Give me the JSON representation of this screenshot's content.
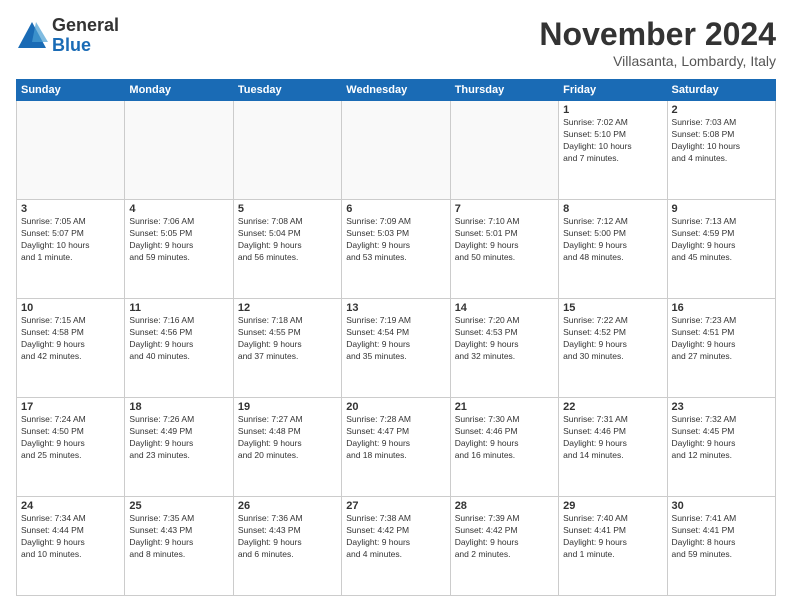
{
  "logo": {
    "general": "General",
    "blue": "Blue"
  },
  "title": "November 2024",
  "location": "Villasanta, Lombardy, Italy",
  "days_header": [
    "Sunday",
    "Monday",
    "Tuesday",
    "Wednesday",
    "Thursday",
    "Friday",
    "Saturday"
  ],
  "weeks": [
    [
      {
        "day": "",
        "info": ""
      },
      {
        "day": "",
        "info": ""
      },
      {
        "day": "",
        "info": ""
      },
      {
        "day": "",
        "info": ""
      },
      {
        "day": "",
        "info": ""
      },
      {
        "day": "1",
        "info": "Sunrise: 7:02 AM\nSunset: 5:10 PM\nDaylight: 10 hours\nand 7 minutes."
      },
      {
        "day": "2",
        "info": "Sunrise: 7:03 AM\nSunset: 5:08 PM\nDaylight: 10 hours\nand 4 minutes."
      }
    ],
    [
      {
        "day": "3",
        "info": "Sunrise: 7:05 AM\nSunset: 5:07 PM\nDaylight: 10 hours\nand 1 minute."
      },
      {
        "day": "4",
        "info": "Sunrise: 7:06 AM\nSunset: 5:05 PM\nDaylight: 9 hours\nand 59 minutes."
      },
      {
        "day": "5",
        "info": "Sunrise: 7:08 AM\nSunset: 5:04 PM\nDaylight: 9 hours\nand 56 minutes."
      },
      {
        "day": "6",
        "info": "Sunrise: 7:09 AM\nSunset: 5:03 PM\nDaylight: 9 hours\nand 53 minutes."
      },
      {
        "day": "7",
        "info": "Sunrise: 7:10 AM\nSunset: 5:01 PM\nDaylight: 9 hours\nand 50 minutes."
      },
      {
        "day": "8",
        "info": "Sunrise: 7:12 AM\nSunset: 5:00 PM\nDaylight: 9 hours\nand 48 minutes."
      },
      {
        "day": "9",
        "info": "Sunrise: 7:13 AM\nSunset: 4:59 PM\nDaylight: 9 hours\nand 45 minutes."
      }
    ],
    [
      {
        "day": "10",
        "info": "Sunrise: 7:15 AM\nSunset: 4:58 PM\nDaylight: 9 hours\nand 42 minutes."
      },
      {
        "day": "11",
        "info": "Sunrise: 7:16 AM\nSunset: 4:56 PM\nDaylight: 9 hours\nand 40 minutes."
      },
      {
        "day": "12",
        "info": "Sunrise: 7:18 AM\nSunset: 4:55 PM\nDaylight: 9 hours\nand 37 minutes."
      },
      {
        "day": "13",
        "info": "Sunrise: 7:19 AM\nSunset: 4:54 PM\nDaylight: 9 hours\nand 35 minutes."
      },
      {
        "day": "14",
        "info": "Sunrise: 7:20 AM\nSunset: 4:53 PM\nDaylight: 9 hours\nand 32 minutes."
      },
      {
        "day": "15",
        "info": "Sunrise: 7:22 AM\nSunset: 4:52 PM\nDaylight: 9 hours\nand 30 minutes."
      },
      {
        "day": "16",
        "info": "Sunrise: 7:23 AM\nSunset: 4:51 PM\nDaylight: 9 hours\nand 27 minutes."
      }
    ],
    [
      {
        "day": "17",
        "info": "Sunrise: 7:24 AM\nSunset: 4:50 PM\nDaylight: 9 hours\nand 25 minutes."
      },
      {
        "day": "18",
        "info": "Sunrise: 7:26 AM\nSunset: 4:49 PM\nDaylight: 9 hours\nand 23 minutes."
      },
      {
        "day": "19",
        "info": "Sunrise: 7:27 AM\nSunset: 4:48 PM\nDaylight: 9 hours\nand 20 minutes."
      },
      {
        "day": "20",
        "info": "Sunrise: 7:28 AM\nSunset: 4:47 PM\nDaylight: 9 hours\nand 18 minutes."
      },
      {
        "day": "21",
        "info": "Sunrise: 7:30 AM\nSunset: 4:46 PM\nDaylight: 9 hours\nand 16 minutes."
      },
      {
        "day": "22",
        "info": "Sunrise: 7:31 AM\nSunset: 4:46 PM\nDaylight: 9 hours\nand 14 minutes."
      },
      {
        "day": "23",
        "info": "Sunrise: 7:32 AM\nSunset: 4:45 PM\nDaylight: 9 hours\nand 12 minutes."
      }
    ],
    [
      {
        "day": "24",
        "info": "Sunrise: 7:34 AM\nSunset: 4:44 PM\nDaylight: 9 hours\nand 10 minutes."
      },
      {
        "day": "25",
        "info": "Sunrise: 7:35 AM\nSunset: 4:43 PM\nDaylight: 9 hours\nand 8 minutes."
      },
      {
        "day": "26",
        "info": "Sunrise: 7:36 AM\nSunset: 4:43 PM\nDaylight: 9 hours\nand 6 minutes."
      },
      {
        "day": "27",
        "info": "Sunrise: 7:38 AM\nSunset: 4:42 PM\nDaylight: 9 hours\nand 4 minutes."
      },
      {
        "day": "28",
        "info": "Sunrise: 7:39 AM\nSunset: 4:42 PM\nDaylight: 9 hours\nand 2 minutes."
      },
      {
        "day": "29",
        "info": "Sunrise: 7:40 AM\nSunset: 4:41 PM\nDaylight: 9 hours\nand 1 minute."
      },
      {
        "day": "30",
        "info": "Sunrise: 7:41 AM\nSunset: 4:41 PM\nDaylight: 8 hours\nand 59 minutes."
      }
    ]
  ]
}
